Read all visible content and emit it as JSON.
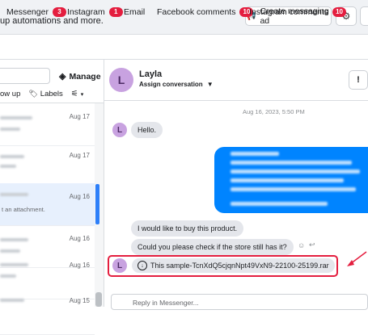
{
  "banner": {
    "text": "up automations and more.",
    "create_ad_label": "Create messaging ad"
  },
  "tabs": [
    {
      "label": "Messenger",
      "count": "3"
    },
    {
      "label": "Instagram",
      "count": "1"
    },
    {
      "label": "Email"
    },
    {
      "label": "Facebook comments",
      "count": "10"
    },
    {
      "label": "Instagram comments",
      "count": "10"
    }
  ],
  "left": {
    "manage_label": "Manage",
    "follow_up_label": "ow up",
    "labels_label": "Labels",
    "items": [
      {
        "date": "Aug 17"
      },
      {
        "date": "Aug 17"
      },
      {
        "date": "Aug 16",
        "snippet": "t an attachment."
      },
      {
        "date": "Aug 16"
      },
      {
        "date": "Aug 16"
      },
      {
        "date": "Aug 15"
      }
    ]
  },
  "chat": {
    "contact_name": "Layla",
    "avatar_initial": "L",
    "assign_label": "Assign conversation",
    "alert_label": "!",
    "timestamp": "Aug 16, 2023, 5:50 PM",
    "messages": {
      "hello": "Hello.",
      "buy": "I would like to buy this product.",
      "check": "Could you please check if the store still has it?",
      "file": "This sample-TcnXdQ5cjqnNpt49VxN9-22100-25199.rar"
    },
    "reply_placeholder": "Reply in Messenger..."
  },
  "colors": {
    "accent_blue": "#0084ff",
    "badge_red": "#e41e3f",
    "avatar_purple": "#c8a2e0"
  }
}
